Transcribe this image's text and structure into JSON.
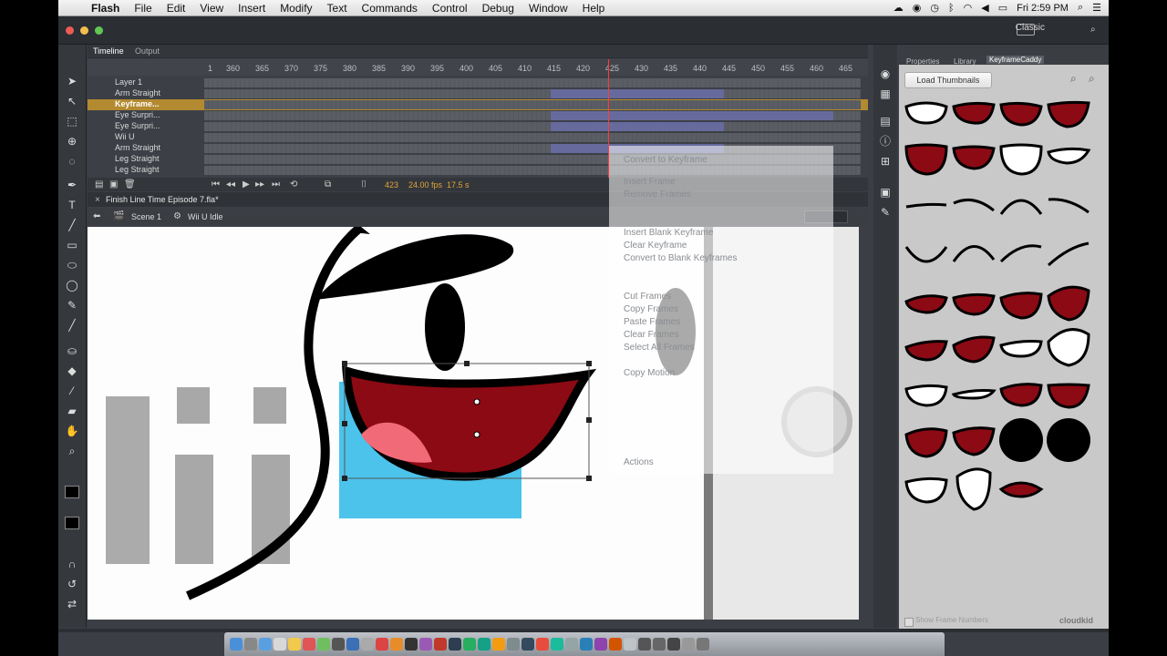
{
  "menubar": {
    "apple": "",
    "items": [
      "Flash",
      "File",
      "Edit",
      "View",
      "Insert",
      "Modify",
      "Text",
      "Commands",
      "Control",
      "Debug",
      "Window",
      "Help"
    ],
    "clock": "Fri 2:59 PM"
  },
  "workspace": "Classic",
  "timeline": {
    "tabs": [
      "Timeline",
      "Output"
    ],
    "ruler": [
      "1",
      "360",
      "365",
      "370",
      "375",
      "380",
      "385",
      "390",
      "395",
      "400",
      "405",
      "410",
      "415",
      "420",
      "425",
      "430",
      "435",
      "440",
      "445",
      "450",
      "455",
      "460",
      "465"
    ],
    "layers": [
      "Layer 1",
      "Arm Straight",
      "Keyframe...",
      "Eye Surpri...",
      "Eye Surpri...",
      "Wii U",
      "Arm Straight",
      "Leg Straight",
      "Leg Straight"
    ],
    "frame": "423",
    "fps": "24.00 fps",
    "time": "17.5 s"
  },
  "document": {
    "tab": "Finish Line Time Episode 7.fla*",
    "scene": "Scene 1",
    "symbol": "Wii U Idle"
  },
  "context_menu": [
    "Convert to Keyframe",
    "Insert Frame",
    "Remove Frames",
    "Insert Blank Keyframe",
    "Clear Keyframe",
    "Convert to Blank Keyframes",
    "Cut Frames",
    "Copy Frames",
    "Paste Frames",
    "Clear Frames",
    "Select All Frames",
    "Copy Motion",
    "Actions"
  ],
  "panel": {
    "tabs": [
      "Properties",
      "Library",
      "KeyframeCaddy"
    ],
    "active_tab": "KeyframeCaddy",
    "load_button": "Load Thumbnails",
    "footer_checkbox": "Show Frame Numbers",
    "brand": "cloudkid"
  },
  "colors": {
    "mouth_red": "#8b0a14",
    "tongue_pink": "#f06a78",
    "wii_blue": "#1eb4e6",
    "tween_purple": "#6b6fb0",
    "playhead": "#ff3b3b"
  }
}
